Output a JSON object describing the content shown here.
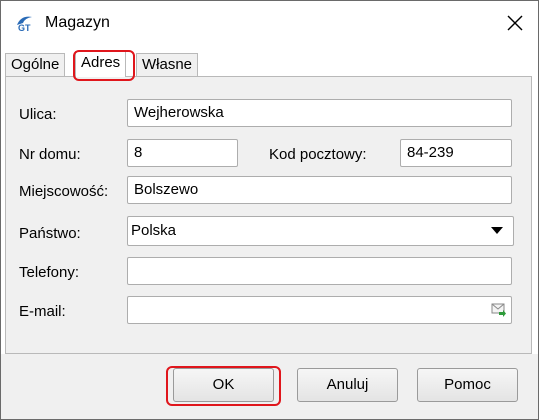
{
  "window": {
    "title": "Magazyn",
    "close_icon": "close-icon",
    "app_icon": "app-logo-icon"
  },
  "tabs": [
    {
      "label": "Ogólne",
      "active": false
    },
    {
      "label": "Adres",
      "active": true
    },
    {
      "label": "Własne",
      "active": false
    }
  ],
  "form": {
    "ulica": {
      "label": "Ulica:",
      "value": "Wejherowska"
    },
    "nr_domu": {
      "label": "Nr domu:",
      "value": "8"
    },
    "kod_pocztowy": {
      "label": "Kod pocztowy:",
      "value": "84-239"
    },
    "miejscowosc": {
      "label": "Miejscowość:",
      "value": "Bolszewo"
    },
    "panstwo": {
      "label": "Państwo:",
      "value": "Polska"
    },
    "telefony": {
      "label": "Telefony:",
      "value": ""
    },
    "email": {
      "label": "E-mail:",
      "value": "",
      "icon": "send-mail-icon"
    }
  },
  "buttons": {
    "ok": "OK",
    "anuluj": "Anuluj",
    "pomoc": "Pomoc"
  },
  "colors": {
    "highlight": "#e0161c",
    "panel_bg": "#f0f0f0"
  }
}
